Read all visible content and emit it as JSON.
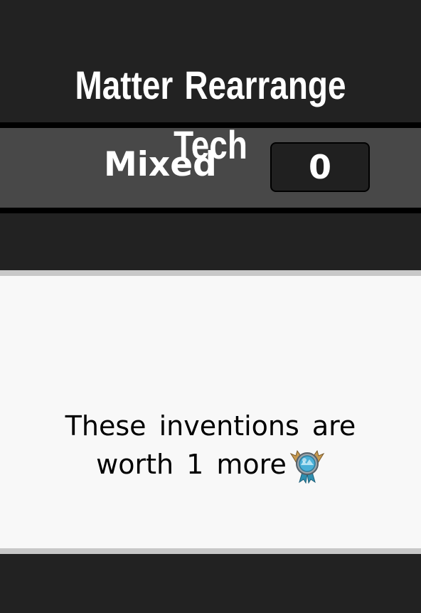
{
  "title": "Matter Rearrange Tech",
  "category": {
    "label": "Mixed",
    "count": "0"
  },
  "info": {
    "line1": "These inventions are",
    "line2": "worth 1 more",
    "icon": "medal-icon"
  },
  "colors": {
    "background": "#222222",
    "bar": "#484848",
    "panel": "#f8f8f8",
    "panel_border": "#c8c8c8",
    "medal_blue": "#4ab0d8",
    "medal_gold": "#c89a50"
  }
}
